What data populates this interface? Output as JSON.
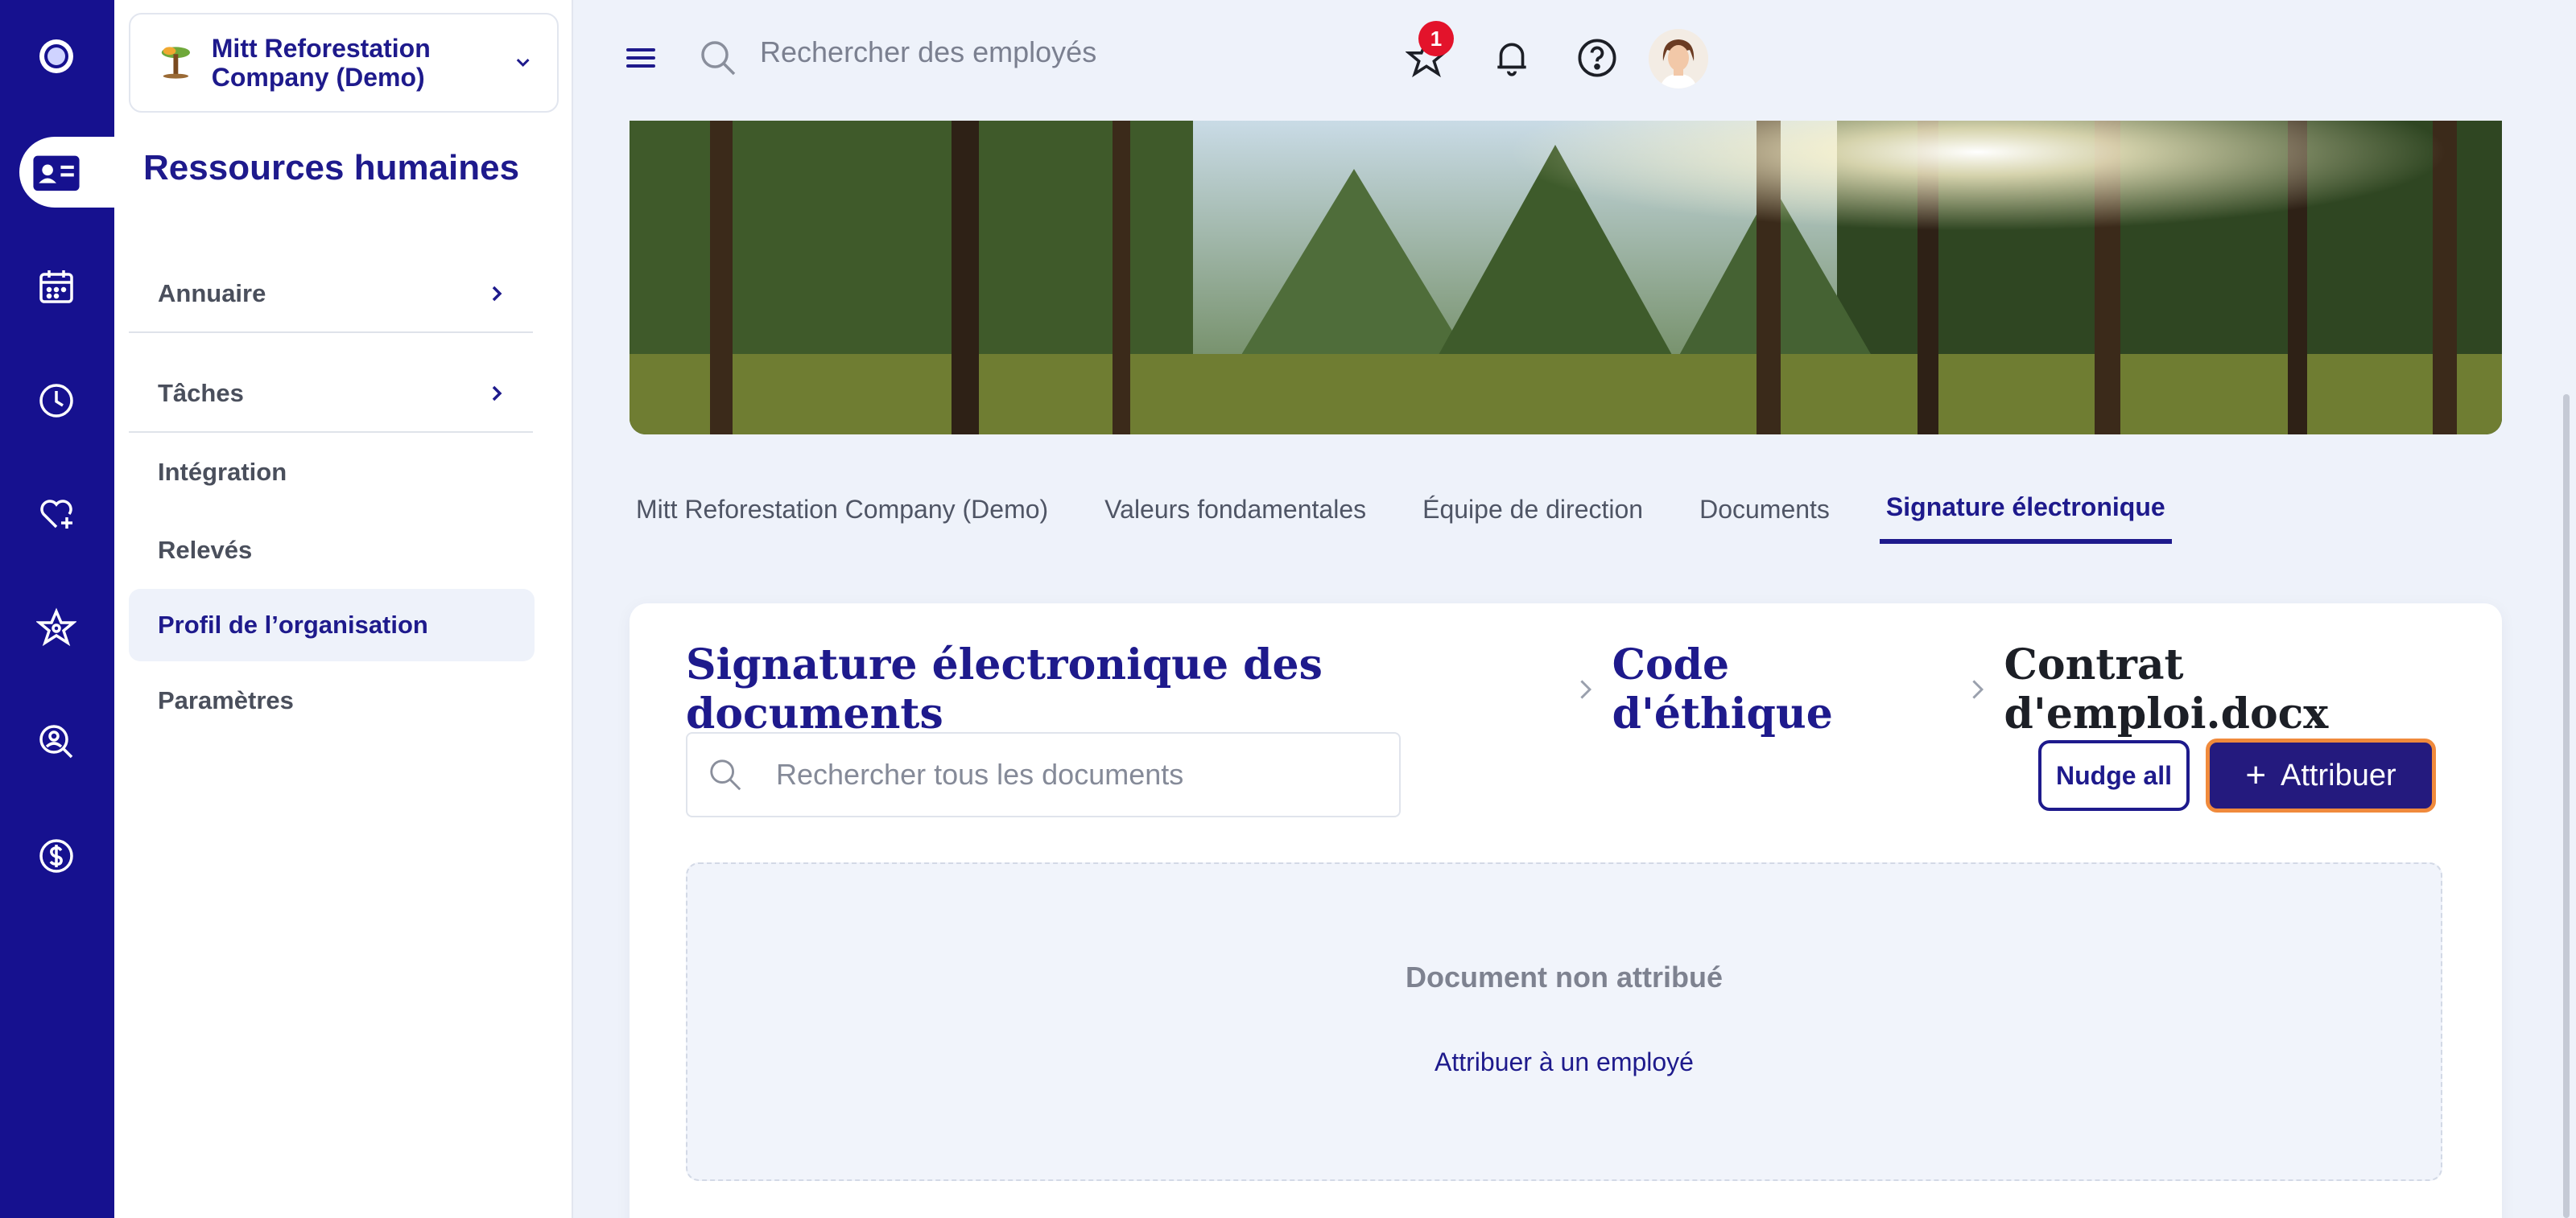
{
  "rail": {
    "items": [
      {
        "name": "home-icon"
      },
      {
        "name": "id-card-icon"
      },
      {
        "name": "calendar-icon"
      },
      {
        "name": "clock-icon"
      },
      {
        "name": "heart-plus-icon"
      },
      {
        "name": "star-icon"
      },
      {
        "name": "search-person-icon"
      },
      {
        "name": "dollar-icon"
      }
    ]
  },
  "sidebar": {
    "org_name": "Mitt Reforestation Company (Demo)",
    "module_title": "Ressources humaines",
    "items": [
      {
        "label": "Annuaire",
        "has_chevron": true
      },
      {
        "label": "Tâches",
        "has_chevron": true
      },
      {
        "label": "Intégration"
      },
      {
        "label": "Relevés"
      },
      {
        "label": "Profil de l’organisation",
        "active": true
      },
      {
        "label": "Paramètres"
      }
    ]
  },
  "topbar": {
    "search_placeholder": "Rechercher des employés",
    "favorites_badge": "1"
  },
  "tabs": [
    {
      "label": "Mitt Reforestation Company (Demo)"
    },
    {
      "label": "Valeurs fondamentales"
    },
    {
      "label": "Équipe de direction"
    },
    {
      "label": "Documents"
    },
    {
      "label": "Signature électronique",
      "active": true
    }
  ],
  "breadcrumb": {
    "level1": "Signature électronique des documents",
    "level2": "Code d'éthique",
    "current": "Contrat d'emploi.docx"
  },
  "doc_search": {
    "placeholder": "Rechercher tous les documents"
  },
  "actions": {
    "nudge_label": "Nudge all",
    "assign_label": "Attribuer"
  },
  "empty_state": {
    "title": "Document non attribué",
    "link": "Attribuer à un employé"
  },
  "colors": {
    "brand": "#16118f",
    "accent_border": "#f08a3c",
    "badge": "#e3132b"
  }
}
